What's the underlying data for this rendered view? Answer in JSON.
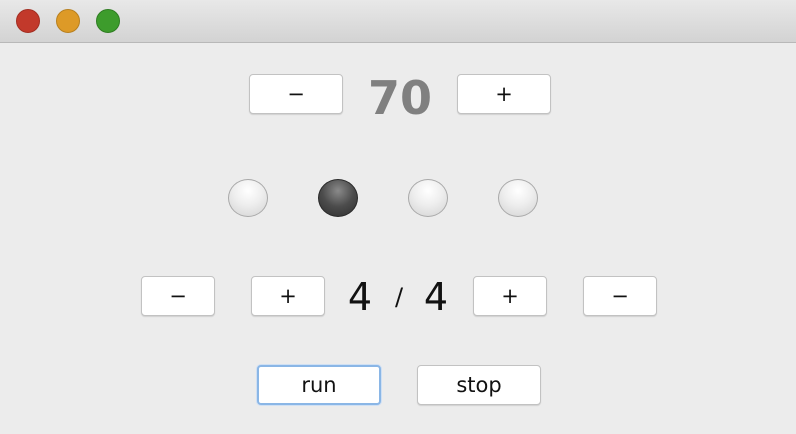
{
  "window": {
    "controls": {
      "close": "close-button",
      "minimize": "minimize-button",
      "zoom": "zoom-button"
    }
  },
  "tempo": {
    "decrease_label": "−",
    "value": "70",
    "increase_label": "+"
  },
  "beats": {
    "count": 4,
    "active_index": 1
  },
  "time_signature": {
    "numerator_decrease_label": "−",
    "numerator_increase_label": "+",
    "numerator": "4",
    "separator": "/",
    "denominator": "4",
    "denominator_increase_label": "+",
    "denominator_decrease_label": "−"
  },
  "controls": {
    "run_label": "run",
    "stop_label": "stop"
  },
  "colors": {
    "background": "#ececec",
    "tempo_text": "#808080",
    "focus_ring": "#8ab6e6",
    "close": "#c2392b",
    "minimize": "#dd9a27",
    "zoom": "#3d9c2c"
  }
}
